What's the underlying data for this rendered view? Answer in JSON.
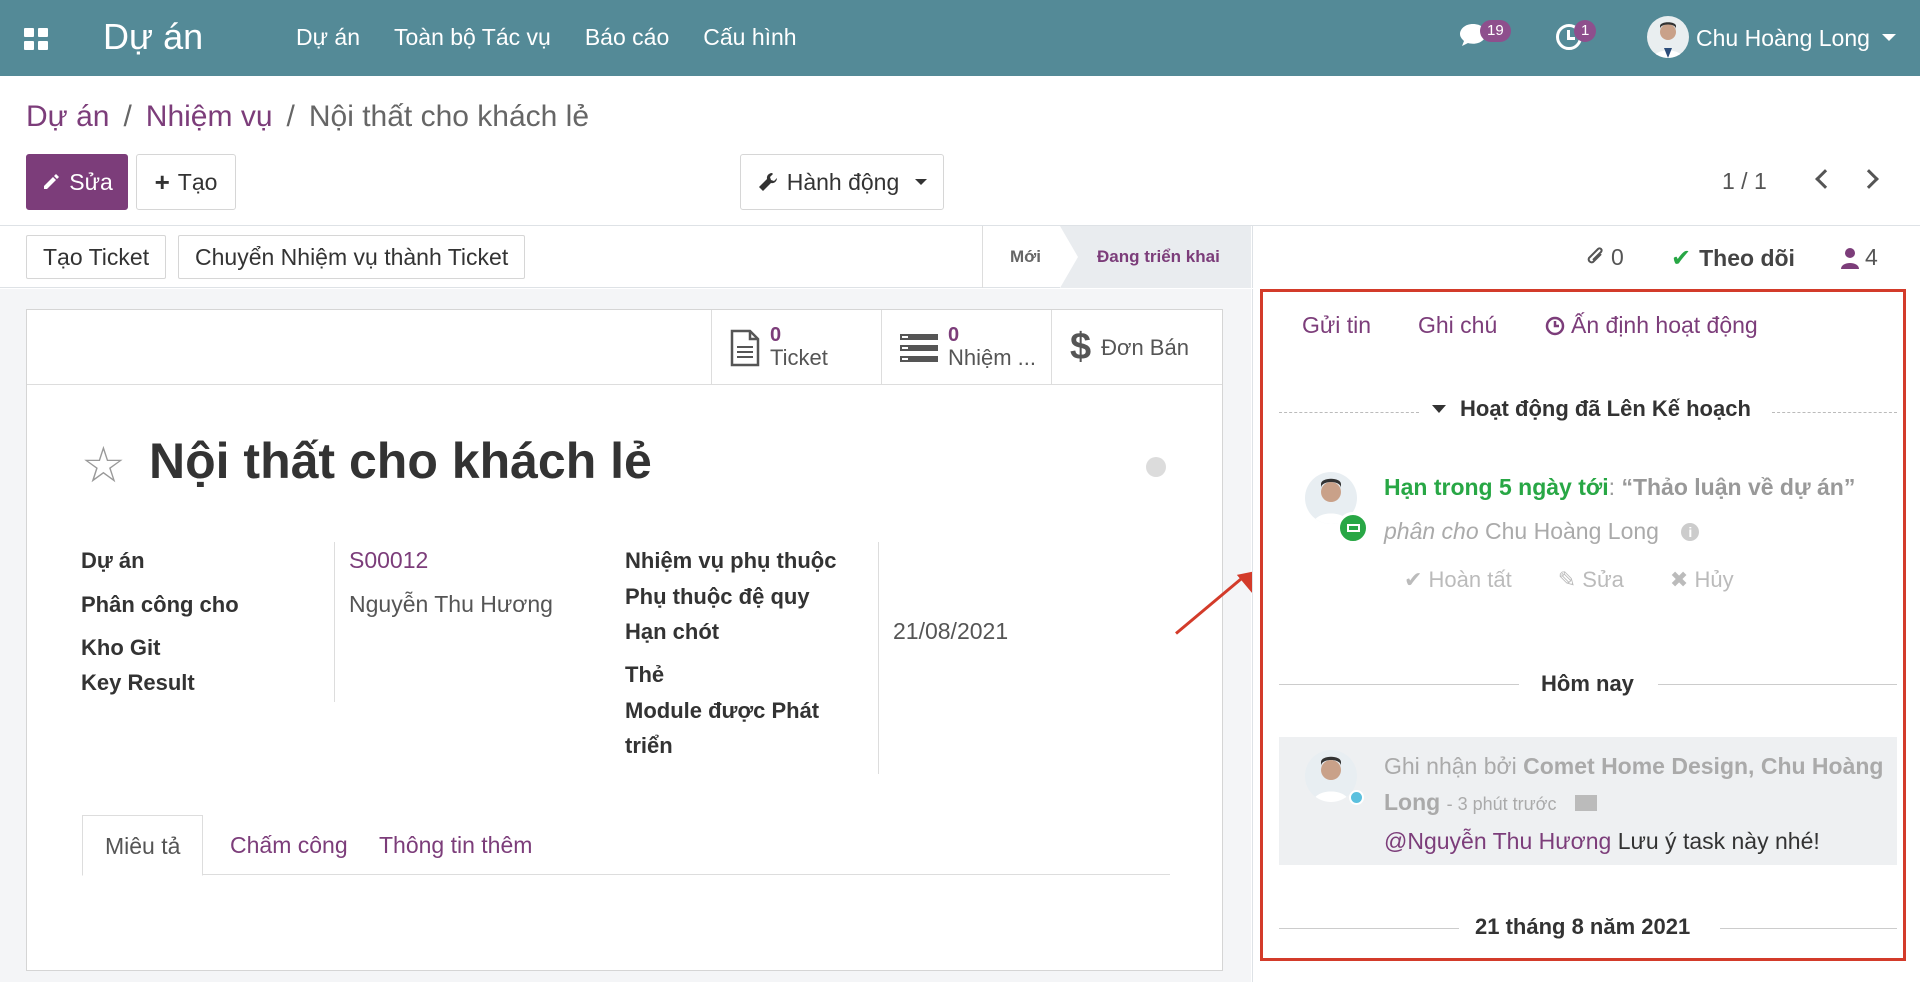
{
  "topbar": {
    "brand": "Dự án",
    "menu": [
      "Dự án",
      "Toàn bộ Tác vụ",
      "Báo cáo",
      "Cấu hình"
    ],
    "messages_count": "19",
    "activities_count": "1",
    "user_name": "Chu Hoàng Long"
  },
  "breadcrumb": {
    "root": "Dự án",
    "parent": "Nhiệm vụ",
    "current": "Nội thất cho khách lẻ",
    "sep": "/"
  },
  "toolbar": {
    "edit_label": "Sửa",
    "create_label": "Tạo",
    "action_label": "Hành động",
    "pager": "1 / 1"
  },
  "statusbar": {
    "create_ticket": "Tạo Ticket",
    "convert_ticket": "Chuyển Nhiệm vụ thành Ticket",
    "stage_new": "Mới",
    "stage_active": "Đang triển khai"
  },
  "smart_buttons": {
    "ticket_count": "0",
    "ticket_label": "Ticket",
    "subtask_count": "0",
    "subtask_label": "Nhiệm ...",
    "sale_label": "Đơn Bán"
  },
  "task": {
    "title": "Nội thất cho khách lẻ",
    "left_labels": {
      "project": "Dự án",
      "assigned": "Phân công cho",
      "git": "Kho Git",
      "key_result": "Key Result"
    },
    "left_values": {
      "project": "S00012",
      "assigned": "Nguyễn Thu Hương"
    },
    "right_labels": {
      "dependent": "Nhiệm vụ phụ thuộc",
      "recursive": "Phụ thuộc đệ quy",
      "deadline": "Hạn chót",
      "tags": "Thẻ",
      "module_1": "Module được Phát",
      "module_2": "triển"
    },
    "right_values": {
      "deadline": "21/08/2021"
    }
  },
  "form_tabs": [
    "Miêu tả",
    "Chấm công",
    "Thông tin thêm"
  ],
  "chatter_top": {
    "attachments": "0",
    "follow": "Theo dõi",
    "followers": "4"
  },
  "chatter": {
    "send": "Gửi tin",
    "note": "Ghi chú",
    "schedule": "Ấn định hoạt động",
    "planned_header": "Hoạt động đã Lên Kế hoạch",
    "activity_due": "Hạn trong 5 ngày tới",
    "activity_colon": ":",
    "activity_summary": "“Thảo luận về dự án”",
    "assigned_prefix": "phân cho",
    "assigned_to": "Chu Hoàng Long",
    "done": "Hoàn tất",
    "edit": "Sửa",
    "cancel": "Hủy",
    "today": "Hôm nay",
    "msg_prefix": "Ghi nhận bởi",
    "msg_authors_1": "Comet Home Design, Chu Hoàng",
    "msg_authors_2": "Long",
    "msg_time": "- 3 phút trước",
    "msg_mention": "@Nguyễn Thu Hương",
    "msg_body": "Lưu ý task này nhé!",
    "date_sep": "21 tháng 8 năm 2021"
  },
  "colors": {
    "topbar": "#548a97",
    "brand_purple": "#7c3d7a",
    "highlight": "#d33b2a",
    "activity_green": "#28a745"
  }
}
